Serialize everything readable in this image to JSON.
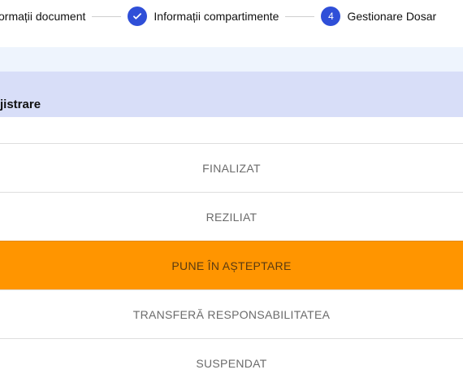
{
  "stepper": {
    "steps": [
      {
        "label": "ormații document",
        "state": "done"
      },
      {
        "label": "Informații compartimente",
        "state": "done",
        "icon": "check-icon"
      },
      {
        "label": "Gestionare Dosar",
        "state": "current",
        "number": "4"
      }
    ]
  },
  "section": {
    "header_label": "jistrare"
  },
  "options": [
    {
      "label": "FINALIZAT"
    },
    {
      "label": "REZILIAT"
    },
    {
      "label": "PUNE ÎN AȘTEPTARE"
    },
    {
      "label": "TRANSFERĂ RESPONSABILITATEA"
    },
    {
      "label": "SUSPENDAT"
    }
  ],
  "colors": {
    "accent_blue": "#2f4fd8",
    "header_band": "#d8def8",
    "active_option": "#ff9500"
  }
}
